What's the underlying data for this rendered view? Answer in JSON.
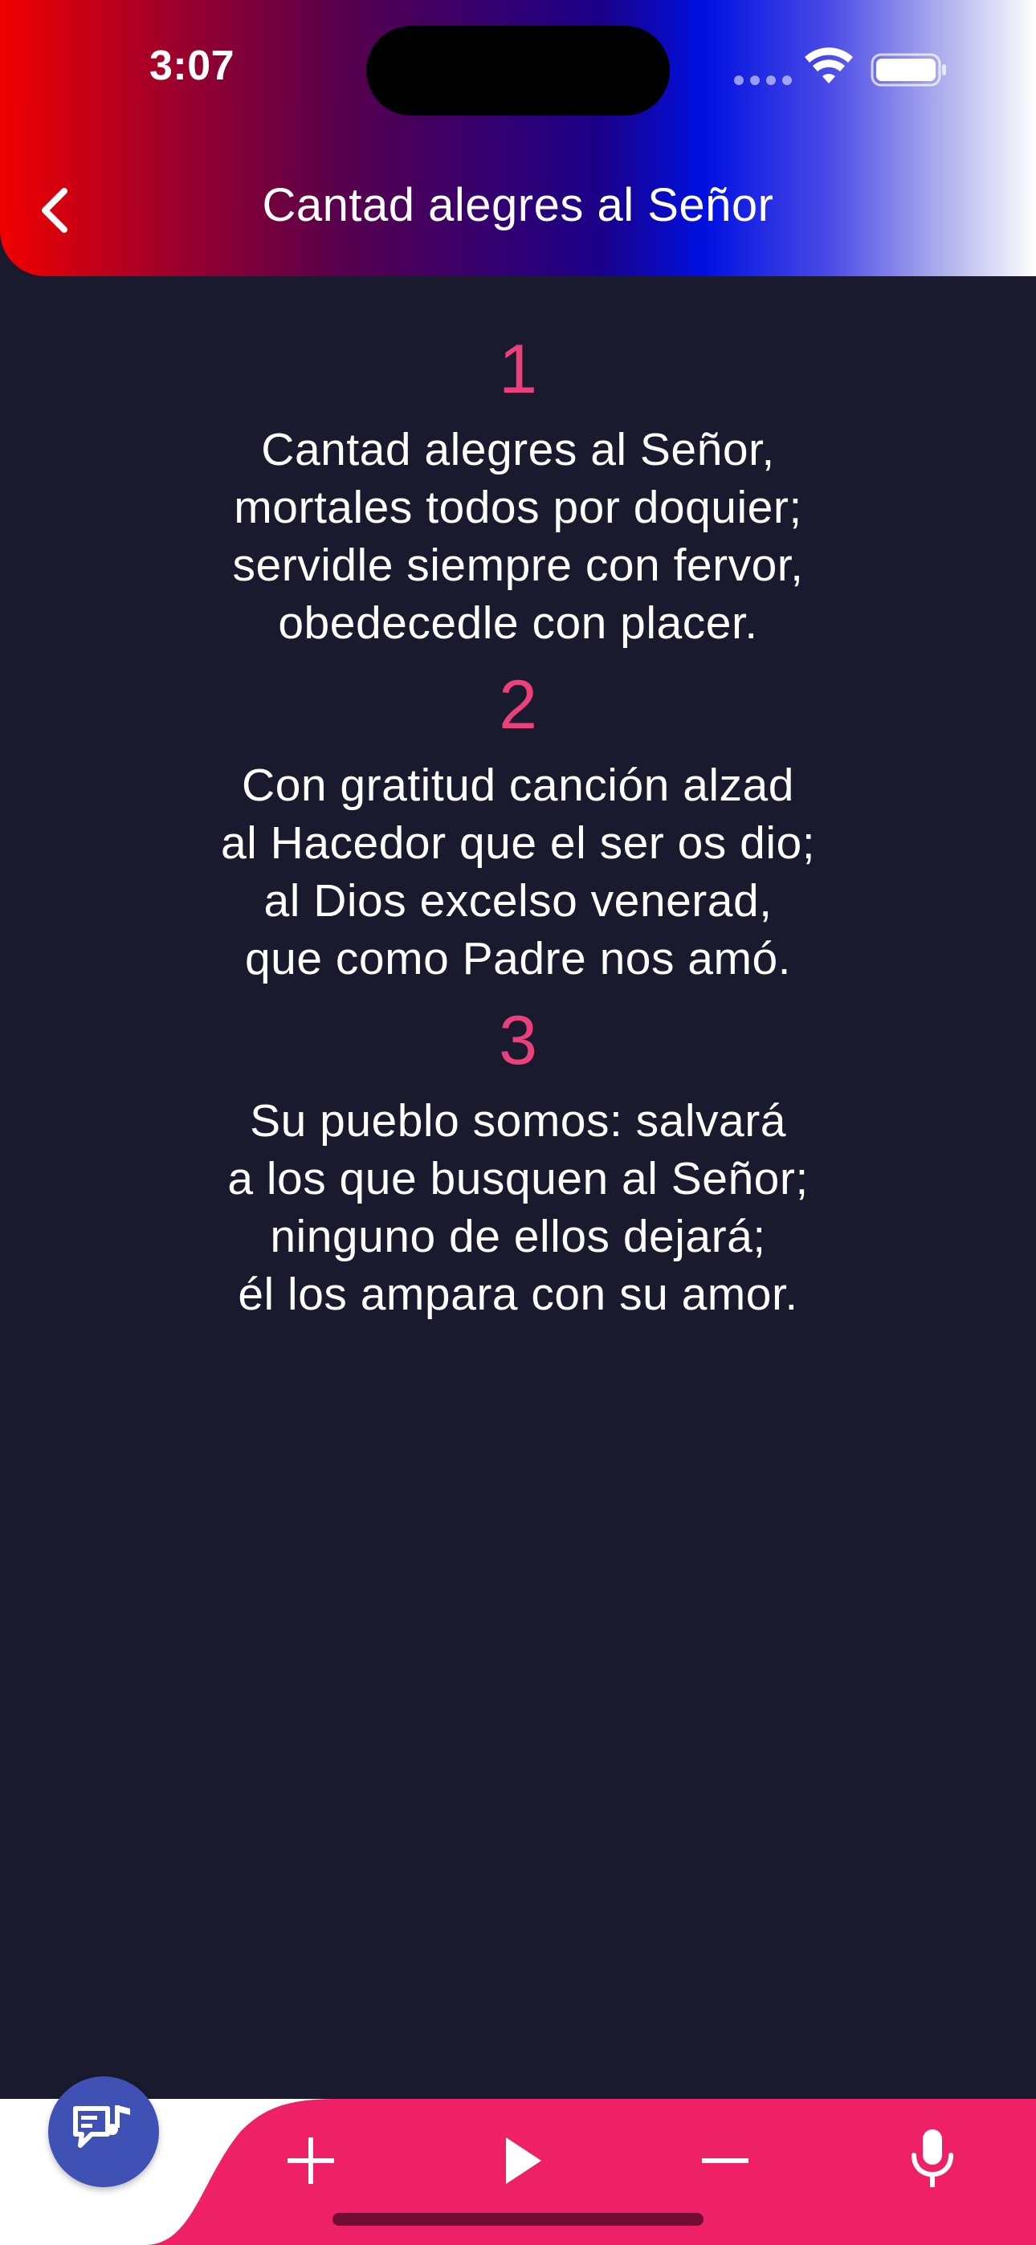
{
  "status_bar": {
    "time": "3:07",
    "wifi_icon": "wifi-icon",
    "battery_icon": "battery-icon"
  },
  "header": {
    "title": "Cantad alegres al Señor",
    "back_icon": "chevron-left-icon",
    "gradient_colors": [
      "#f00000",
      "#5a004a",
      "#0010e0",
      "#ffffff"
    ]
  },
  "hymn": {
    "verses": [
      {
        "number": "1",
        "lines": [
          "Cantad alegres al Señor,",
          "mortales todos por doquier;",
          "servidle siempre con fervor,",
          "obedecedle con placer."
        ]
      },
      {
        "number": "2",
        "lines": [
          "Con gratitud canción alzad",
          "al Hacedor que el ser os dio;",
          "al Dios excelso venerad,",
          "que como Padre nos amó."
        ]
      },
      {
        "number": "3",
        "lines": [
          "Su pueblo somos: salvará",
          "a los que busquen al Señor;",
          "ninguno de ellos dejará;",
          "él los ampara con su amor."
        ]
      }
    ]
  },
  "bottom_bar": {
    "fab_icon": "lyrics-music-icon",
    "buttons": [
      {
        "name": "increase-font-button",
        "icon": "plus-icon"
      },
      {
        "name": "play-button",
        "icon": "play-icon"
      },
      {
        "name": "decrease-font-button",
        "icon": "minus-icon"
      },
      {
        "name": "microphone-button",
        "icon": "microphone-icon"
      }
    ]
  },
  "colors": {
    "background": "#1a1a2e",
    "verse_number": "#ec407a",
    "text": "#ffffff",
    "bottom_bar": "#ee2066",
    "fab": "#3f51b5"
  }
}
